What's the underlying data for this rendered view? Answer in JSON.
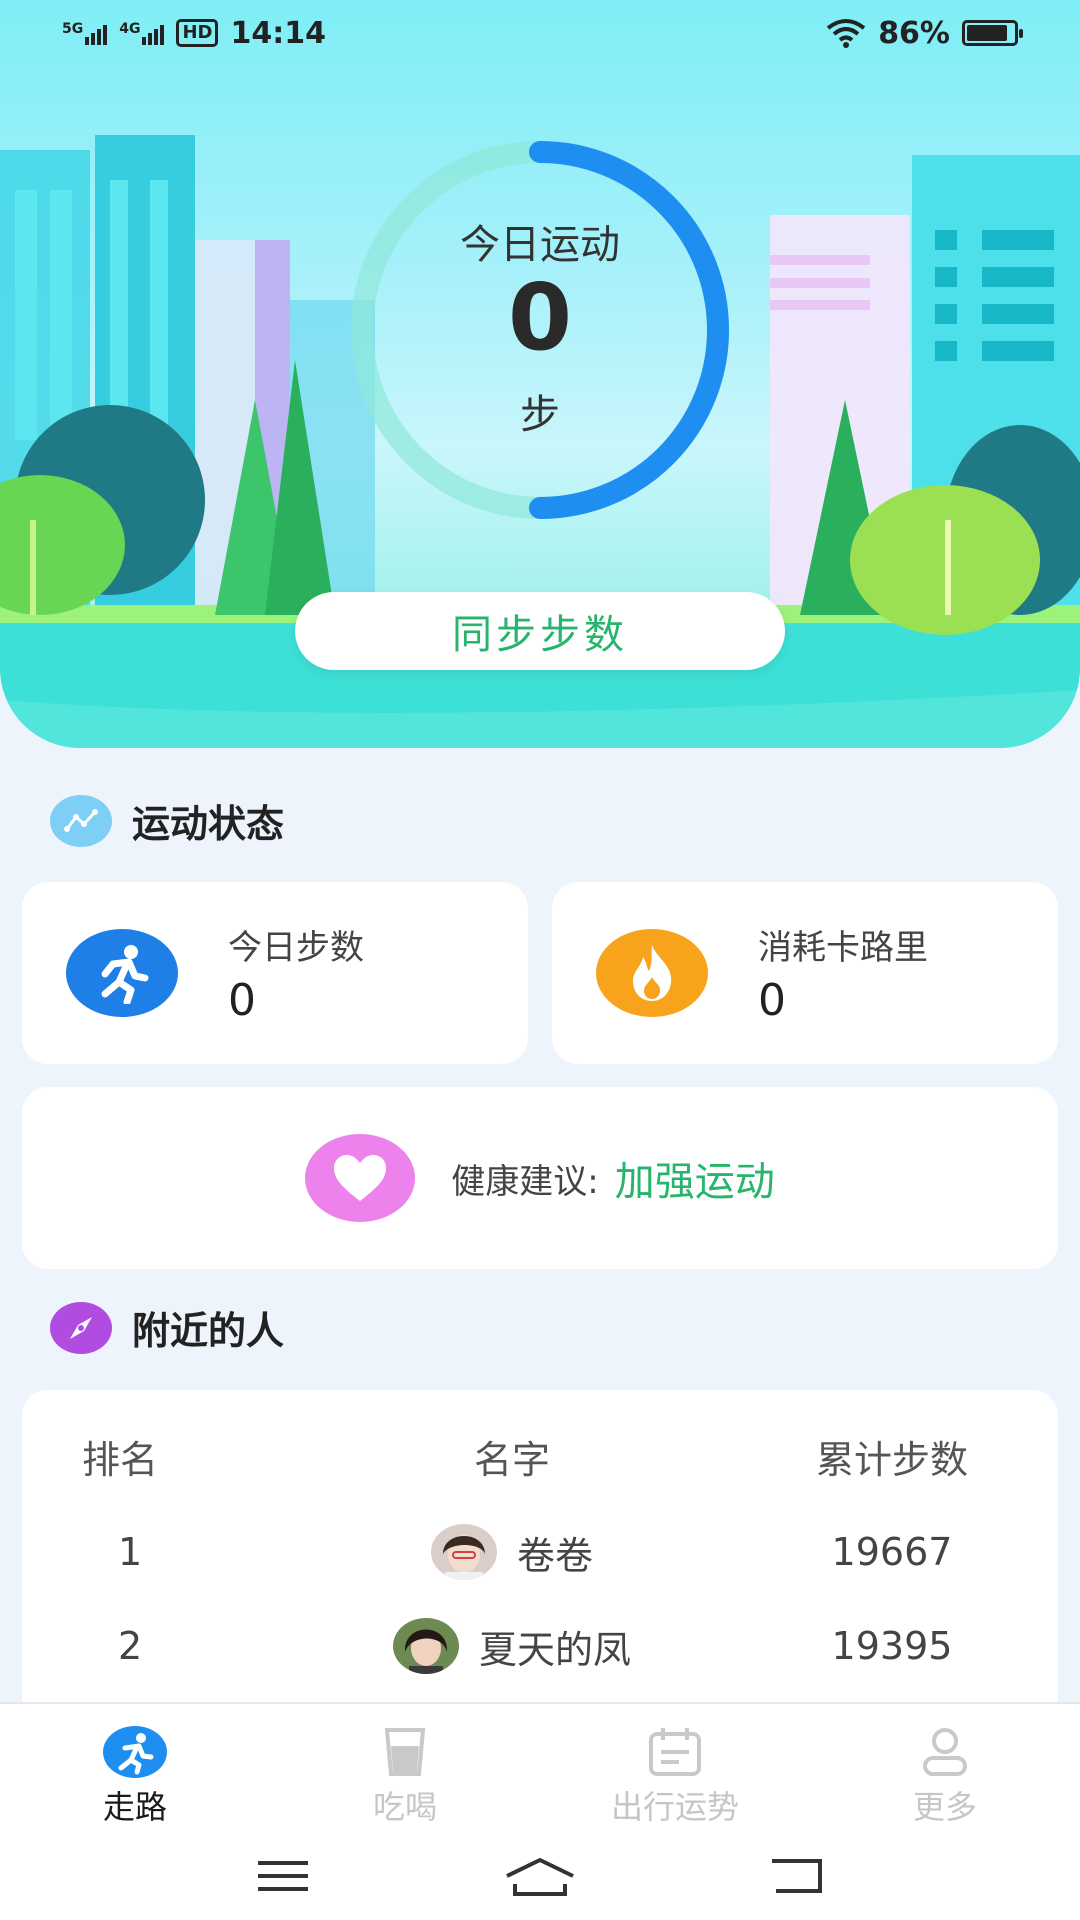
{
  "status_bar": {
    "signal1_label": "5G",
    "signal2_label": "4G",
    "hd_label": "HD",
    "time": "14:14",
    "battery": "86%"
  },
  "hero": {
    "ring_title": "今日运动",
    "ring_value": "0",
    "ring_unit": "步",
    "sync_button": "同步步数"
  },
  "exercise_section": {
    "title": "运动状态",
    "today_steps_label": "今日步数",
    "today_steps_value": "0",
    "calories_label": "消耗卡路里",
    "calories_value": "0"
  },
  "advice": {
    "label": "健康建议:",
    "value": "加强运动"
  },
  "nearby": {
    "title": "附近的人",
    "headers": {
      "rank": "排名",
      "name": "名字",
      "steps": "累计步数"
    },
    "rows": [
      {
        "rank": "1",
        "name": "卷卷",
        "steps": "19667"
      },
      {
        "rank": "2",
        "name": "夏天的凤",
        "steps": "19395"
      }
    ]
  },
  "tabs": [
    {
      "label": "走路",
      "icon": "running-icon",
      "active": true
    },
    {
      "label": "吃喝",
      "icon": "cup-icon",
      "active": false
    },
    {
      "label": "出行运势",
      "icon": "calendar-icon",
      "active": false
    },
    {
      "label": "更多",
      "icon": "user-icon",
      "active": false
    }
  ],
  "colors": {
    "primary_blue": "#1e8ff0",
    "accent_green": "#27b46c",
    "calorie_orange": "#f7a31c",
    "heart_pink": "#ee82ec",
    "nearby_purple": "#b04ce0"
  },
  "ring_progress": 0.5
}
